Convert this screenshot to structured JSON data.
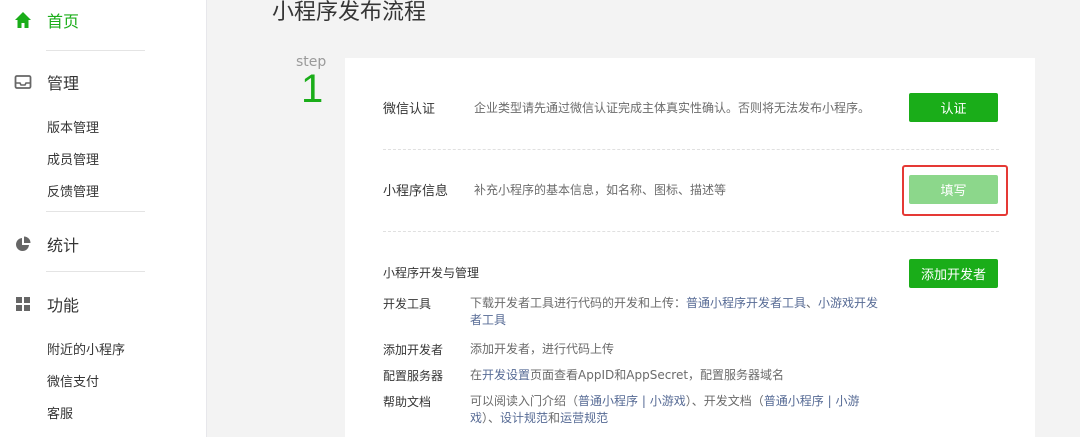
{
  "colors": {
    "accent": "#1aad19",
    "link": "#576b95",
    "highlight": "#e53935"
  },
  "sidebar": {
    "home": {
      "icon": "home-icon",
      "label": "首页"
    },
    "manage": {
      "icon": "management-icon",
      "label": "管理",
      "items": [
        "版本管理",
        "成员管理",
        "反馈管理"
      ]
    },
    "stats": {
      "icon": "pie-chart-icon",
      "label": "统计"
    },
    "features": {
      "icon": "grid-icon",
      "label": "功能",
      "items": [
        "附近的小程序",
        "微信支付",
        "客服"
      ]
    }
  },
  "main": {
    "title": "小程序发布流程",
    "step_word": "step",
    "step_number": "1",
    "verify": {
      "label": "微信认证",
      "desc": "企业类型请先通过微信认证完成主体真实性确认。否则将无法发布小程序。",
      "button": "认证"
    },
    "info": {
      "label": "小程序信息",
      "desc": "补充小程序的基本信息，如名称、图标、描述等",
      "button": "填写"
    },
    "dev": {
      "title": "小程序开发与管理",
      "add_button": "添加开发者",
      "tools": {
        "label": "开发工具",
        "text1": "下载开发者工具进行代码的开发和上传：",
        "link1": "普通小程序开发者工具",
        "sep": "、",
        "link2a": "小游戏开发",
        "link2b": "者工具"
      },
      "add_dev": {
        "label": "添加开发者",
        "text": "添加开发者，进行代码上传"
      },
      "server": {
        "label": "配置服务器",
        "text1": "在",
        "link": "开发设置",
        "text2": "页面查看AppID和AppSecret，配置服务器域名"
      },
      "docs": {
        "label": "帮助文档",
        "t1": "可以阅读入门介绍（",
        "l1": "普通小程序",
        "s1": "|",
        "l2": "小游戏",
        "t2": "）、开发文档（",
        "l3": "普通小程序",
        "s2": "|",
        "l4": "小游",
        "l4b": "戏",
        "t3": "）、",
        "l5": "设计规范",
        "t4": "和",
        "l6": "运营规范"
      }
    }
  }
}
